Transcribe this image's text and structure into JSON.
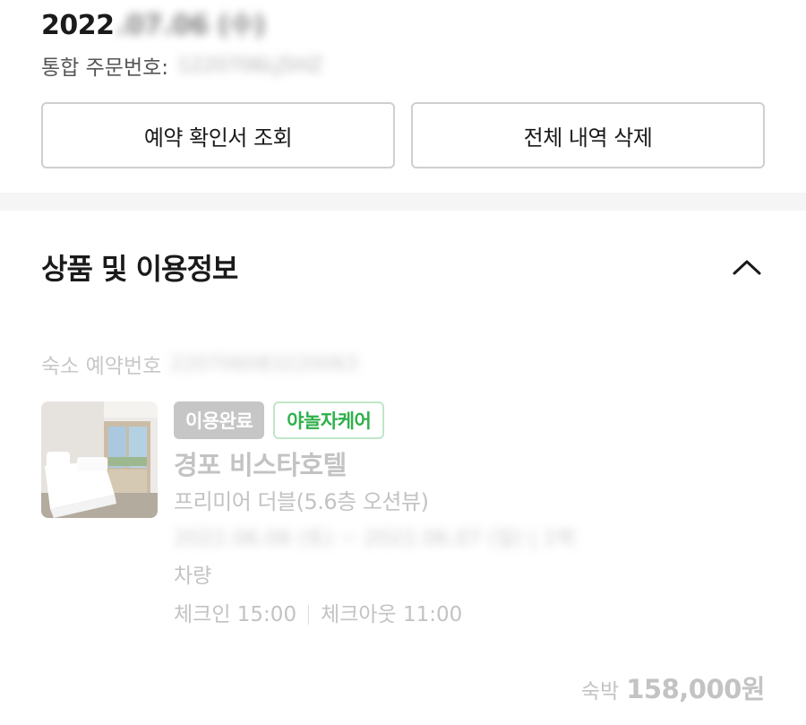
{
  "order": {
    "date_visible": "2022",
    "date_blurred": ".07.06 (수)",
    "number_label": "통합 주문번호:",
    "number_blurred": "1220706LJ5HZ"
  },
  "buttons": {
    "view_confirmation": "예약 확인서 조회",
    "delete_all_history": "전체 내역 삭제"
  },
  "section": {
    "title": "상품 및 이용정보",
    "collapse_icon": "chevron-up-icon"
  },
  "booking": {
    "number_label": "숙소 예약번호",
    "number_blurred": "220706083220063"
  },
  "product": {
    "status_badge": "이용완료",
    "care_badge": "야놀자케어",
    "hotel_name": "경포 비스타호텔",
    "room_type": "프리미어 더블(5.6층 오션뷰)",
    "stay_dates_blurred": "2022.06.06 (토) ~ 2022.06.07 (일) | 1박",
    "vehicle": "차량",
    "checkin": "체크인 15:00",
    "checkout": "체크아웃 11:00"
  },
  "price": {
    "label": "숙박",
    "value": "158,000원"
  },
  "colors": {
    "badge_done_bg": "#c6c6c6",
    "badge_care_text": "#2fb04a",
    "badge_care_border": "#bfe6c8",
    "muted_text": "#c3c3c3"
  }
}
